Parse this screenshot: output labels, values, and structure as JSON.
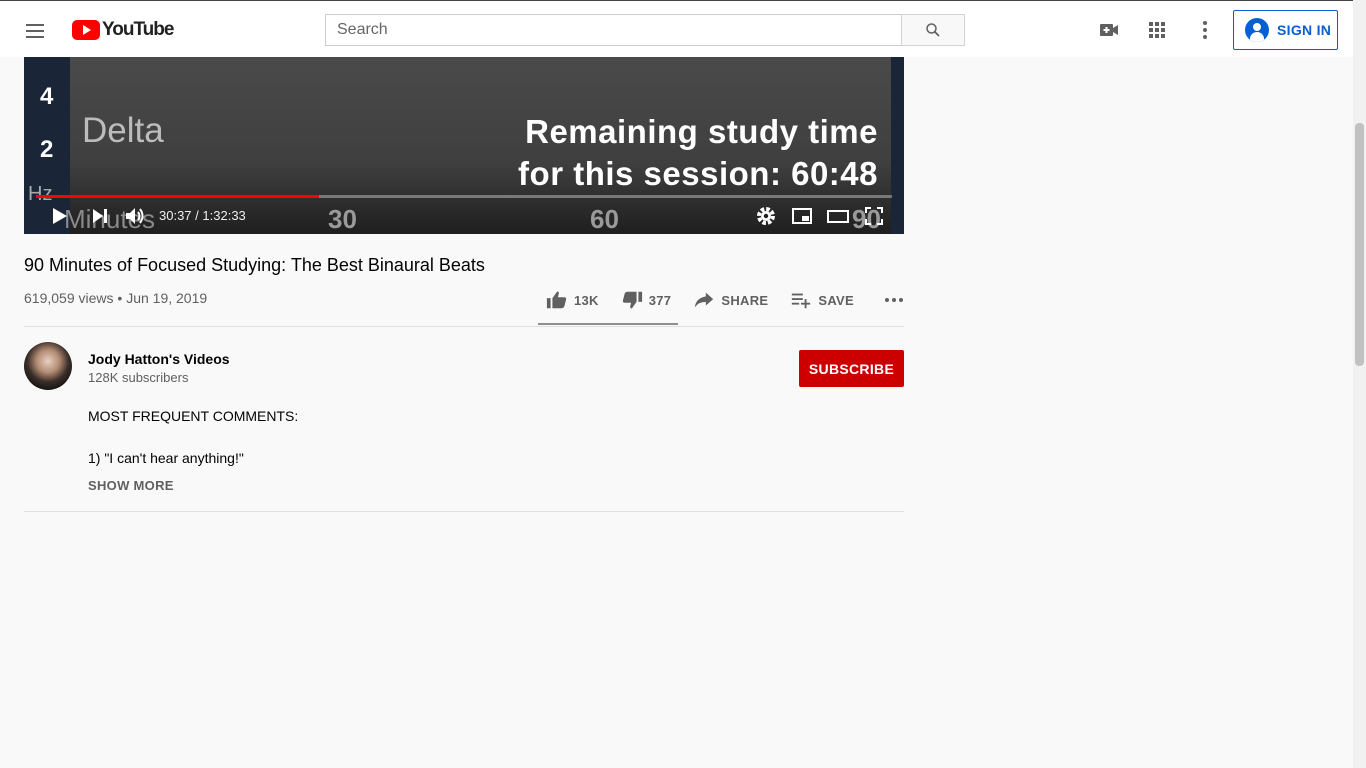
{
  "header": {
    "logo_text": "YouTube",
    "search_placeholder": "Search",
    "sign_in_label": "SIGN IN"
  },
  "player": {
    "overlay": {
      "axis_ticks": [
        "4",
        "2"
      ],
      "axis_unit": "Hz",
      "band_label": "Delta",
      "remaining_line1": "Remaining study time",
      "remaining_line2": "for this session: 60:48",
      "x_axis_label": "Minutes",
      "x_ticks": [
        "30",
        "60",
        "90"
      ]
    },
    "current_time": "30:37",
    "duration": "1:32:33",
    "progress_fraction": 0.331
  },
  "video": {
    "title": "90 Minutes of Focused Studying: The Best Binaural Beats",
    "views": "619,059 views",
    "date": "Jun 19, 2019",
    "likes": "13K",
    "dislikes": "377",
    "share_label": "SHARE",
    "save_label": "SAVE"
  },
  "channel": {
    "name": "Jody Hatton's Videos",
    "subscribers": "128K subscribers",
    "subscribe_label": "SUBSCRIBE"
  },
  "description": {
    "line1": "MOST FREQUENT COMMENTS:",
    "line2": "1) \"I can't hear anything!\"",
    "show_more_label": "SHOW MORE"
  },
  "colors": {
    "brand_red": "#ff0000",
    "subscribe_red": "#cc0000",
    "link_blue": "#065fd4"
  }
}
